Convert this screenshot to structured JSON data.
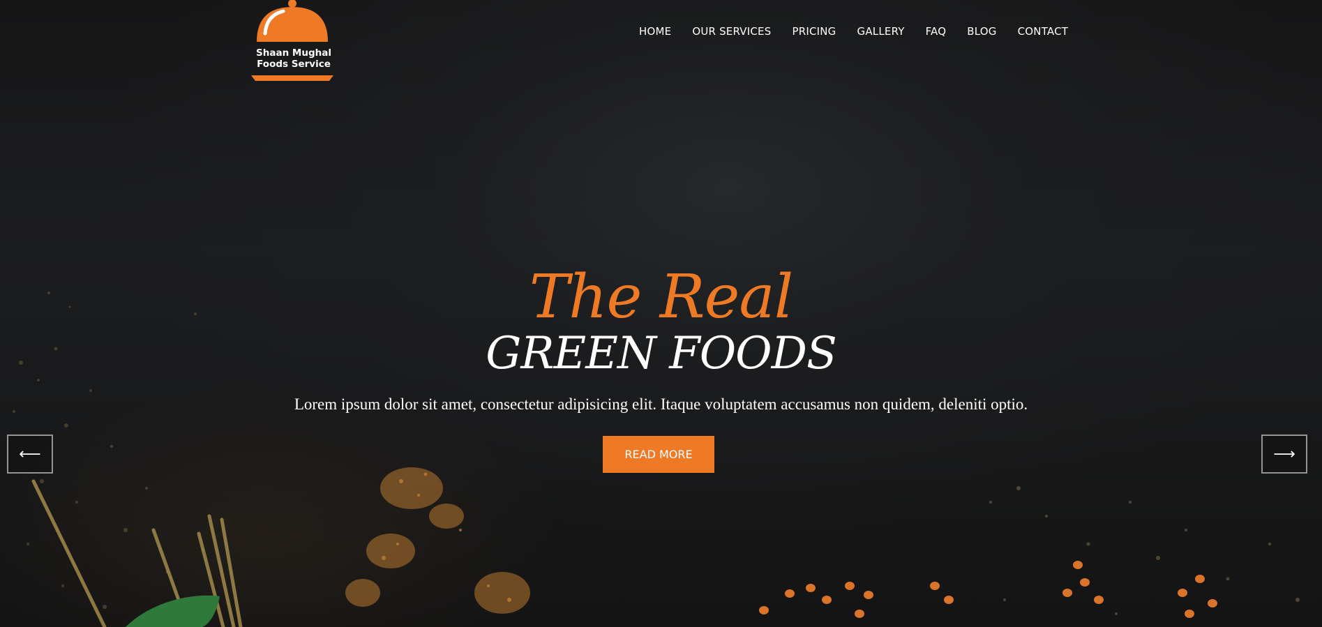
{
  "brand": {
    "name_line1": "Shaan Mughal",
    "name_line2": "Foods Service",
    "accent": "#ee7a25",
    "icon": "cloche-icon"
  },
  "nav": {
    "items": [
      "HOME",
      "OUR SERVICES",
      "PRICING",
      "GALLERY",
      "FAQ",
      "BLOG",
      "CONTACT"
    ]
  },
  "hero": {
    "title_line1": "The Real",
    "title_line2": "GREEN FOODS",
    "subtitle": "Lorem ipsum dolor sit amet, consectetur adipisicing elit. Itaque voluptatem accusamus non quidem, deleniti optio.",
    "cta_label": "READ MORE"
  },
  "slider": {
    "prev_icon": "arrow-left-icon",
    "prev_glyph": "⟵",
    "next_icon": "arrow-right-icon",
    "next_glyph": "⟶"
  }
}
